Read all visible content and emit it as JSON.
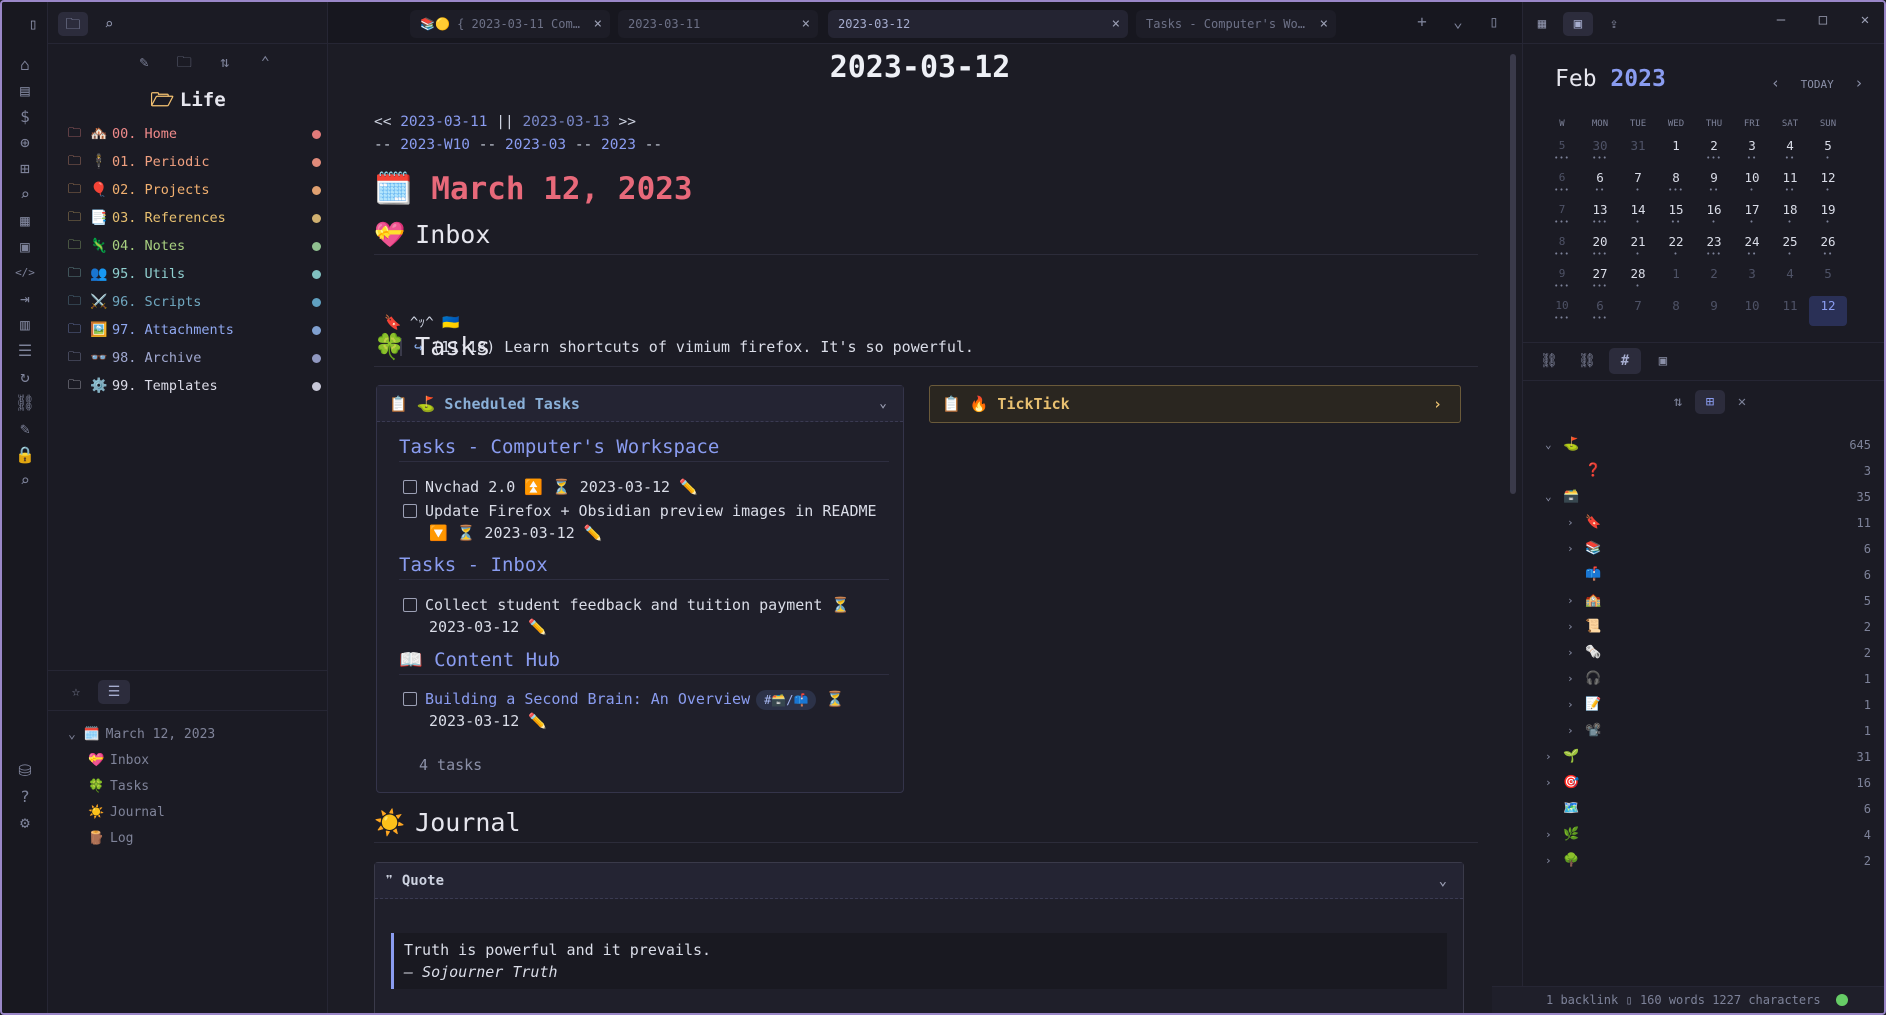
{
  "colors": {
    "accent": "#8a9cf0",
    "heading_red": "#e8697a",
    "folder_home": "#f08a8a",
    "folder_periodic": "#f0a080",
    "folder_projects": "#f2b070",
    "folder_references": "#e8c070",
    "folder_notes": "#a8d080",
    "folder_utils": "#90d0d0",
    "folder_scripts": "#70a8c0",
    "folder_attachments": "#90a8f0",
    "folder_archive": "#a0a8d0",
    "folder_templates": "#dcdce8"
  },
  "ribbon": {
    "icons": [
      "home-icon",
      "file-icon",
      "dollar-icon",
      "plus-circle-icon",
      "add-note-icon",
      "search-icon",
      "dashboard-icon",
      "calendar-icon",
      "code-icon",
      "login-icon",
      "table-icon",
      "list-icon",
      "refresh-icon",
      "link-icon",
      "wand-icon",
      "lock-icon",
      "zoom-icon",
      "vault-icon",
      "help-icon",
      "settings-icon"
    ],
    "glyphs": [
      "⌂",
      "▤",
      "$",
      "⊕",
      "⊞",
      "⌕",
      "▦",
      "▣",
      "</>",
      "⇥",
      "▥",
      "☰",
      "↻",
      "⛓",
      "✎",
      "🔒",
      "⌕",
      "⛁",
      "?",
      "⚙"
    ]
  },
  "left_sidebar": {
    "vault_title": "Life",
    "folders": [
      {
        "name": "00. Home",
        "emoji": "🏘️",
        "color": "#f08a8a",
        "dot": "#e07a7a"
      },
      {
        "name": "01. Periodic",
        "emoji": "🕴️",
        "color": "#f0a080",
        "dot": "#e08a7a"
      },
      {
        "name": "02. Projects",
        "emoji": "🎈",
        "color": "#f2b070",
        "dot": "#e0a070"
      },
      {
        "name": "03. References",
        "emoji": "📑",
        "color": "#e8c070",
        "dot": "#d0b070"
      },
      {
        "name": "04. Notes",
        "emoji": "🦎",
        "color": "#a8d080",
        "dot": "#90c090"
      },
      {
        "name": "95. Utils",
        "emoji": "👥",
        "color": "#90d0d0",
        "dot": "#80c0c0"
      },
      {
        "name": "96. Scripts",
        "emoji": "⚔️",
        "color": "#70a8c0",
        "dot": "#60a0c0"
      },
      {
        "name": "97. Attachments",
        "emoji": "🖼️",
        "color": "#90a8f0",
        "dot": "#80a0d0"
      },
      {
        "name": "98. Archive",
        "emoji": "👓",
        "color": "#a0a8d0",
        "dot": "#9098c0"
      },
      {
        "name": "99. Templates",
        "emoji": "⚙️",
        "color": "#dcdce8",
        "dot": "#c8c8d8"
      }
    ],
    "outline": [
      {
        "label": "March 12, 2023",
        "emoji": "🗓️",
        "indent": 0
      },
      {
        "label": "Inbox",
        "emoji": "💝",
        "indent": 1
      },
      {
        "label": "Tasks",
        "emoji": "🍀",
        "indent": 1
      },
      {
        "label": "Journal",
        "emoji": "☀️",
        "indent": 1
      },
      {
        "label": "Log",
        "emoji": "🪵",
        "indent": 1
      }
    ]
  },
  "tabs": [
    {
      "label": "📚🟡 { 2023-03-11 Com…",
      "active": false
    },
    {
      "label": "2023-03-11",
      "active": false
    },
    {
      "label": "2023-03-12",
      "active": true
    },
    {
      "label": "Tasks - Computer's Wo…",
      "active": false
    }
  ],
  "note": {
    "title": "2023-03-12",
    "nav1_prefix": "<<",
    "nav1_prev": "2023-03-11",
    "nav1_sep": "||",
    "nav1_next": "2023-03-13",
    "nav1_suffix": ">>",
    "nav2_d1": "--",
    "nav2_week": "2023-W10",
    "nav2_d2": "--",
    "nav2_month": "2023-03",
    "nav2_d3": "--",
    "nav2_year": "2023",
    "nav2_d4": "--",
    "h1_emoji": "🗓️",
    "h1": "March 12, 2023",
    "inbox_emoji": "💝",
    "inbox_heading": "Inbox",
    "inbox_tag": "^ｯ^ 🇺🇦",
    "inbox_item": "(11:18) Learn shortcuts of vimium firefox. It's so powerful.",
    "tasks_emoji": "🍀",
    "tasks_heading": "Tasks",
    "scheduled_title": "📋 ⛳ Scheduled Tasks",
    "sec1": "Tasks - Computer's Workspace",
    "task1": "Nvchad 2.0 ⏫ ⏳ 2023-03-12 ✏️",
    "task2_line1": "Update Firefox + Obsidian preview images in README",
    "task2_line2": "🔽 ⏳ 2023-03-12 ✏️",
    "sec2": "Tasks - Inbox",
    "task3_line1": "Collect student feedback and tuition payment ⏳",
    "task3_line2": "2023-03-12 ✏️",
    "sec3": "📖 Content Hub",
    "task4_link": "Building a Second Brain: An Overview",
    "task4_tag": "#🗃️/📫",
    "task4_after": "⏳",
    "task4_line2": "2023-03-12 ✏️",
    "tasks_count": "4 tasks",
    "ticktick_title": "📋 🔥 TickTick",
    "journal_emoji": "☀️",
    "journal_heading": "Journal",
    "quote_header": "❞ Quote",
    "quote_text": "Truth is powerful and it prevails.",
    "quote_author": "— Sojourner Truth"
  },
  "calendar": {
    "month": "Feb",
    "year": "2023",
    "today_label": "TODAY",
    "headers": [
      "W",
      "MON",
      "TUE",
      "WED",
      "THU",
      "FRI",
      "SAT",
      "SUN"
    ],
    "weeks": [
      {
        "w": "5",
        "days": [
          "30",
          "31",
          "1",
          "2",
          "3",
          "4",
          "5"
        ],
        "dim": [
          true,
          true,
          false,
          false,
          false,
          false,
          false
        ],
        "dots": [
          "•••",
          "",
          "",
          "•••",
          "••",
          "••",
          "•"
        ]
      },
      {
        "w": "6",
        "days": [
          "6",
          "7",
          "8",
          "9",
          "10",
          "11",
          "12"
        ],
        "dim": [
          false,
          false,
          false,
          false,
          false,
          false,
          false
        ],
        "dots": [
          "••",
          "•",
          "•••",
          "••",
          "•",
          "••",
          "•"
        ]
      },
      {
        "w": "7",
        "days": [
          "13",
          "14",
          "15",
          "16",
          "17",
          "18",
          "19"
        ],
        "dim": [
          false,
          false,
          false,
          false,
          false,
          false,
          false
        ],
        "dots": [
          "•••",
          "•",
          "••",
          "•",
          "•",
          "•",
          "•"
        ]
      },
      {
        "w": "8",
        "days": [
          "20",
          "21",
          "22",
          "23",
          "24",
          "25",
          "26"
        ],
        "dim": [
          false,
          false,
          false,
          false,
          false,
          false,
          false
        ],
        "dots": [
          "•••",
          "•",
          "•",
          "•••",
          "••",
          "•",
          "••"
        ]
      },
      {
        "w": "9",
        "days": [
          "27",
          "28",
          "1",
          "2",
          "3",
          "4",
          "5"
        ],
        "dim": [
          false,
          false,
          true,
          true,
          true,
          true,
          true
        ],
        "dots": [
          "•••",
          "•",
          "",
          "",
          "",
          "",
          ""
        ]
      },
      {
        "w": "10",
        "days": [
          "6",
          "7",
          "8",
          "9",
          "10",
          "11",
          "12"
        ],
        "dim": [
          true,
          true,
          true,
          true,
          true,
          true,
          true
        ],
        "dots": [
          "•••",
          "",
          "",
          "",
          "",
          "",
          ""
        ]
      }
    ]
  },
  "tag_tree": [
    {
      "emoji": "⛳",
      "count": "645",
      "level": 0,
      "chevron": "⌄"
    },
    {
      "emoji": "❓",
      "count": "3",
      "level": 1,
      "chevron": ""
    },
    {
      "emoji": "🗃️",
      "count": "35",
      "level": 0,
      "chevron": "⌄"
    },
    {
      "emoji": "🔖",
      "count": "11",
      "level": 1,
      "chevron": "›"
    },
    {
      "emoji": "📚",
      "count": "6",
      "level": 1,
      "chevron": "›"
    },
    {
      "emoji": "📫",
      "count": "6",
      "level": 1,
      "chevron": ""
    },
    {
      "emoji": "🏫",
      "count": "5",
      "level": 1,
      "chevron": "›"
    },
    {
      "emoji": "📜",
      "count": "2",
      "level": 1,
      "chevron": "›"
    },
    {
      "emoji": "🗞️",
      "count": "2",
      "level": 1,
      "chevron": "›"
    },
    {
      "emoji": "🎧",
      "count": "1",
      "level": 1,
      "chevron": "›"
    },
    {
      "emoji": "📝",
      "count": "1",
      "level": 1,
      "chevron": "›"
    },
    {
      "emoji": "📽️",
      "count": "1",
      "level": 1,
      "chevron": "›"
    },
    {
      "emoji": "🌱",
      "count": "31",
      "level": 0,
      "chevron": "›"
    },
    {
      "emoji": "🎯",
      "count": "16",
      "level": 0,
      "chevron": "›"
    },
    {
      "emoji": "🗺️",
      "count": "6",
      "level": 0,
      "chevron": ""
    },
    {
      "emoji": "🌿",
      "count": "4",
      "level": 0,
      "chevron": "›"
    },
    {
      "emoji": "🌳",
      "count": "2",
      "level": 0,
      "chevron": "›"
    }
  ],
  "status": {
    "backlinks": "1 backlink",
    "words": "160 words",
    "chars": "1227 characters"
  }
}
